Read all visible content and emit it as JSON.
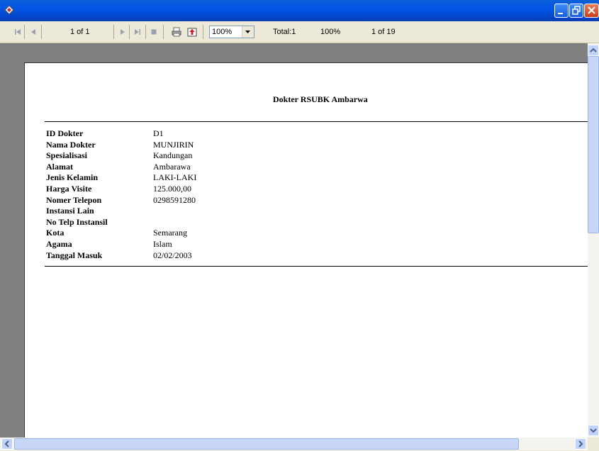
{
  "toolbar": {
    "page_indicator": "1 of 1",
    "zoom": "100%",
    "total": "Total:1",
    "percent": "100%",
    "records": "1 of 19"
  },
  "report": {
    "title": "Dokter RSUBK Ambarwa",
    "fields": [
      {
        "label": "ID Dokter",
        "value": "D1"
      },
      {
        "label": "Nama Dokter",
        "value": "MUNJIRIN"
      },
      {
        "label": "Spesialisasi",
        "value": "Kandungan"
      },
      {
        "label": "Alamat",
        "value": "Ambarawa"
      },
      {
        "label": "Jenis Kelamin",
        "value": "LAKI-LAKI"
      },
      {
        "label": "Harga  Visite",
        "value": " 125.000,00"
      },
      {
        "label": "Nomer Telepon",
        "value": "0298591280"
      },
      {
        "label": "Instansi Lain",
        "value": ""
      },
      {
        "label": "No Telp Instansil",
        "value": ""
      },
      {
        "label": "Kota",
        "value": "Semarang"
      },
      {
        "label": "Agama",
        "value": "Islam"
      },
      {
        "label": "Tanggal Masuk",
        "value": "02/02/2003"
      }
    ]
  },
  "icons": [
    "app-icon",
    "first-page-icon",
    "prev-page-icon",
    "next-page-icon",
    "last-page-icon",
    "stop-icon",
    "print-icon",
    "export-icon",
    "minimize-icon",
    "maximize-icon",
    "close-icon"
  ]
}
